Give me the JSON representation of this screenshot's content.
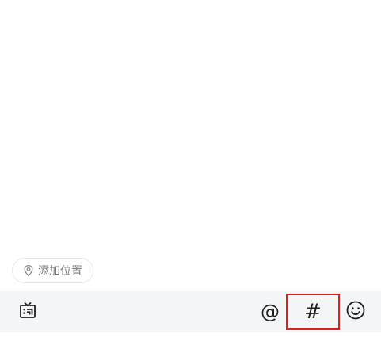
{
  "location": {
    "label": "添加位置",
    "icon": "map-pin-icon"
  },
  "toolbar": {
    "media_icon": "media-frame-icon",
    "mention_glyph": "@",
    "topic_glyph": "#",
    "emoji_icon": "smiley-icon",
    "highlight_color": "#e02020",
    "background": "#f4f5f7"
  }
}
